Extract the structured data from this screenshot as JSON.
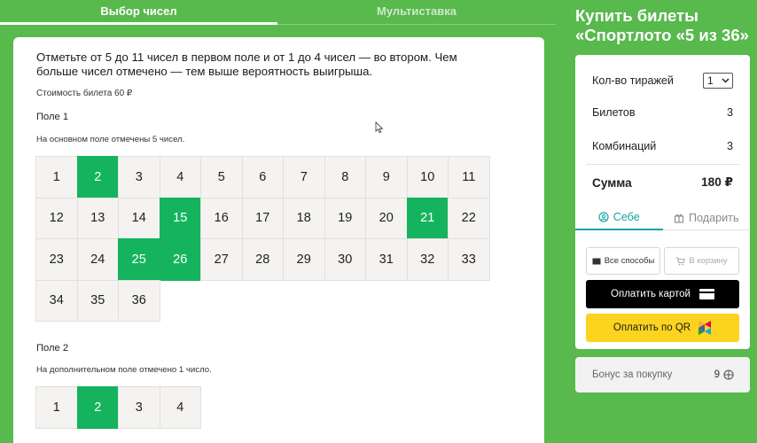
{
  "tabs": [
    {
      "label": "Выбор чисел",
      "active": true
    },
    {
      "label": "Мультиставка",
      "active": false
    }
  ],
  "main": {
    "intro": "Отметьте от 5 до 11 чисел в первом поле и от 1 до 4 чисел — во втором. Чем больше чисел отмечено — тем выше вероятность выигрыша.",
    "price": "Стоимость билета 60 ₽",
    "field1": {
      "title": "Поле 1",
      "note": "На основном поле отмечены 5 чисел.",
      "numbers": [
        "1",
        "2",
        "3",
        "4",
        "5",
        "6",
        "7",
        "8",
        "9",
        "10",
        "11",
        "12",
        "13",
        "14",
        "15",
        "16",
        "17",
        "18",
        "19",
        "20",
        "21",
        "22",
        "23",
        "24",
        "25",
        "26",
        "27",
        "28",
        "29",
        "30",
        "31",
        "32",
        "33",
        "34",
        "35",
        "36"
      ],
      "selected": [
        "2",
        "15",
        "21",
        "25",
        "26"
      ]
    },
    "field2": {
      "title": "Поле 2",
      "note": "На дополнительном поле отмечено 1 число.",
      "numbers": [
        "1",
        "2",
        "3",
        "4"
      ],
      "selected": [
        "2"
      ]
    }
  },
  "sidebar": {
    "title": "Купить билеты «Спортлото «5 из 36»",
    "draws_label": "Кол-во тиражей",
    "draws_value": "1",
    "tickets_label": "Билетов",
    "tickets_value": "3",
    "combos_label": "Комбинаций",
    "combos_value": "3",
    "sum_label": "Сумма",
    "sum_value": "180 ₽",
    "for_self": "Себе",
    "gift": "Подарить",
    "all_methods": "Все способы",
    "to_cart": "В корзину",
    "pay_card": "Оплатить картой",
    "pay_qr": "Оплатить по QR"
  },
  "bonus": {
    "label": "Бонус за покупку",
    "value": "9"
  },
  "colors": {
    "background": "#58b94d",
    "selected_cell": "#15b35e",
    "accent_teal": "#1aa3a3",
    "qr_button": "#fcd31e"
  }
}
